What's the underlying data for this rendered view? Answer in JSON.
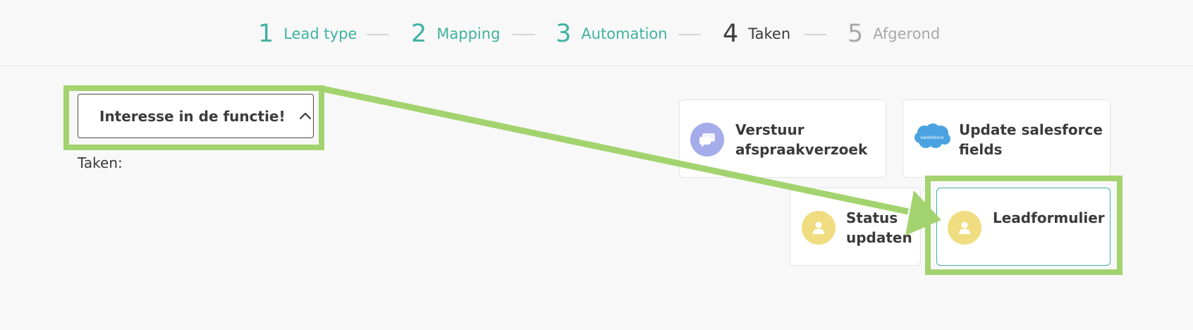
{
  "steps": [
    {
      "number": "1",
      "label": "Lead type",
      "state": "done"
    },
    {
      "number": "2",
      "label": "Mapping",
      "state": "done"
    },
    {
      "number": "3",
      "label": "Automation",
      "state": "done"
    },
    {
      "number": "4",
      "label": "Taken",
      "state": "current"
    },
    {
      "number": "5",
      "label": "Afgerond",
      "state": "todo"
    }
  ],
  "dropdown": {
    "label": "Interesse in de functie!",
    "expanded": true,
    "icon": "chevron-up-icon"
  },
  "tasks_label": "Taken:",
  "task_cards": [
    {
      "id": "verstuur",
      "line1": "Verstuur",
      "line2": "afspraakverzoek",
      "icon": "chat-bubbles-icon"
    },
    {
      "id": "salesforce",
      "line1": "Update salesforce",
      "line2": "fields",
      "icon": "salesforce-logo-icon",
      "icon_text": "salesforce"
    },
    {
      "id": "status",
      "line1": "Status",
      "line2": "updaten",
      "icon": "user-icon"
    },
    {
      "id": "leadformulier",
      "line1": "Leadformulier",
      "line2": "",
      "icon": "user-icon",
      "selected": true
    }
  ],
  "colors": {
    "accent": "#3fb2a1",
    "highlight": "#a3d36f",
    "icon_purple": "#a4acea",
    "icon_yellow": "#f1dd81",
    "salesforce_blue": "#4aa3e0"
  }
}
